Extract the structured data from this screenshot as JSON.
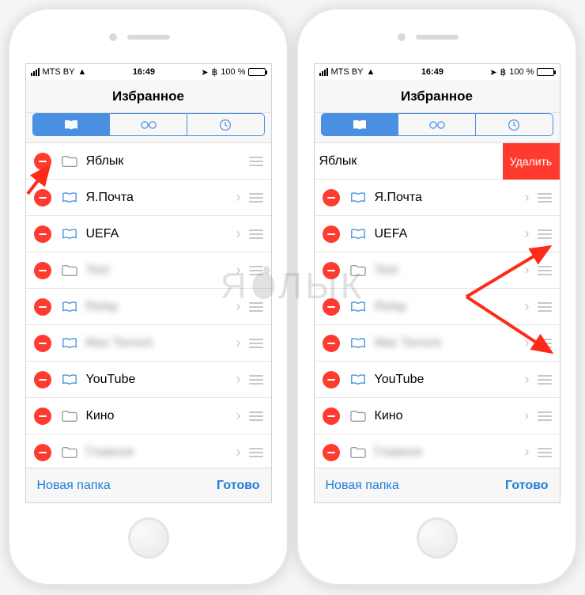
{
  "status": {
    "carrier": "MTS BY",
    "wifi": true,
    "time": "16:49",
    "battery_pct": "100 %"
  },
  "header": {
    "title": "Избранное"
  },
  "segments": [
    "bookmarks",
    "reading-list",
    "history"
  ],
  "toolbar": {
    "new_folder": "Новая папка",
    "done": "Готово"
  },
  "delete_label": "Удалить",
  "left_phone": {
    "rows": [
      {
        "kind": "folder",
        "label": "Яблык",
        "blurred": false,
        "chevron": false
      },
      {
        "kind": "bookmark",
        "label": "Я.Почта",
        "blurred": false,
        "chevron": true
      },
      {
        "kind": "bookmark",
        "label": "UEFA",
        "blurred": false,
        "chevron": true
      },
      {
        "kind": "folder",
        "label": "Test",
        "blurred": true,
        "chevron": true
      },
      {
        "kind": "bookmark",
        "label": "Relay",
        "blurred": true,
        "chevron": true
      },
      {
        "kind": "bookmark",
        "label": "Mac Torrent",
        "blurred": true,
        "chevron": true
      },
      {
        "kind": "bookmark",
        "label": "YouTube",
        "blurred": false,
        "chevron": true
      },
      {
        "kind": "folder",
        "label": "Кино",
        "blurred": false,
        "chevron": true
      },
      {
        "kind": "folder",
        "label": "Главное",
        "blurred": true,
        "chevron": true
      }
    ]
  },
  "right_phone": {
    "rows": [
      {
        "kind": "folder",
        "label": "Яблык",
        "blurred": false,
        "chevron": false,
        "shifted": true
      },
      {
        "kind": "bookmark",
        "label": "Я.Почта",
        "blurred": false,
        "chevron": true
      },
      {
        "kind": "bookmark",
        "label": "UEFA",
        "blurred": false,
        "chevron": true
      },
      {
        "kind": "folder",
        "label": "Test",
        "blurred": true,
        "chevron": true
      },
      {
        "kind": "bookmark",
        "label": "Relay",
        "blurred": true,
        "chevron": true
      },
      {
        "kind": "bookmark",
        "label": "Mac Torrent",
        "blurred": true,
        "chevron": true
      },
      {
        "kind": "bookmark",
        "label": "YouTube",
        "blurred": false,
        "chevron": true
      },
      {
        "kind": "folder",
        "label": "Кино",
        "blurred": false,
        "chevron": true
      },
      {
        "kind": "folder",
        "label": "Главное",
        "blurred": true,
        "chevron": true
      }
    ]
  },
  "watermark": "ЯБЛЫК"
}
